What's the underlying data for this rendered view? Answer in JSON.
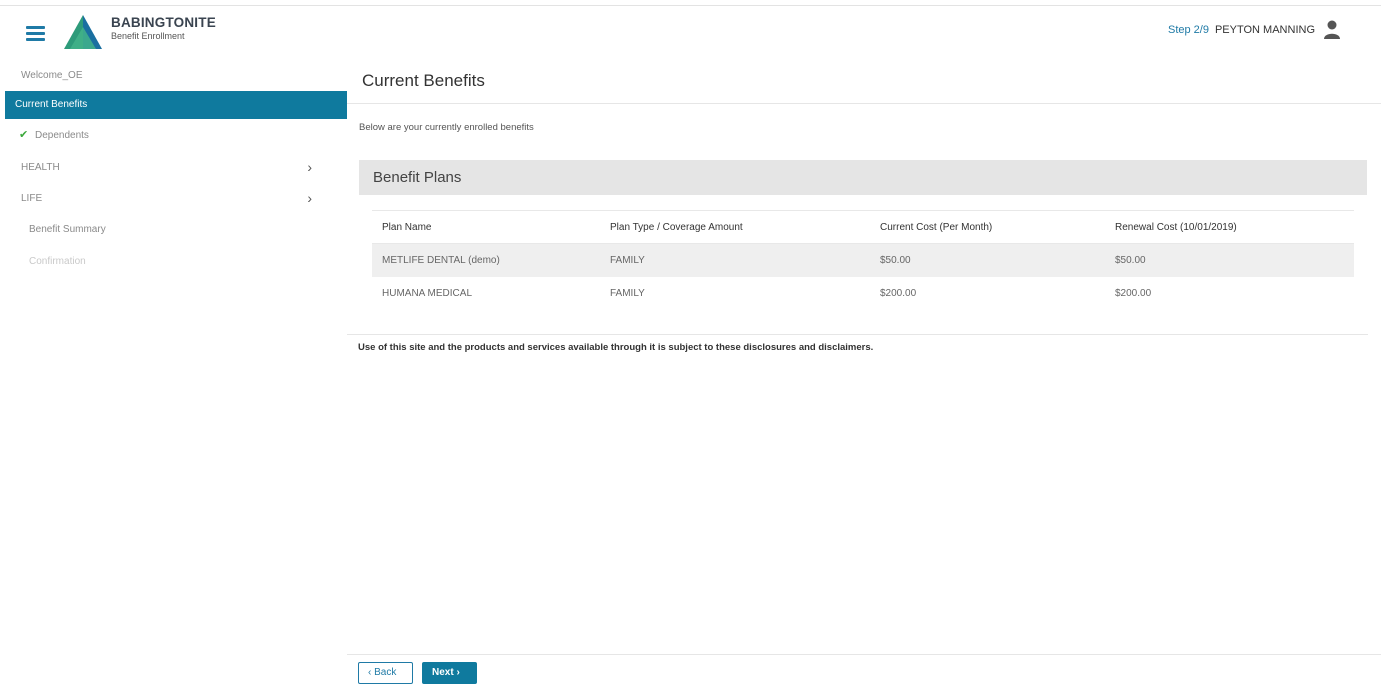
{
  "header": {
    "brand_name": "BABINGTONITE",
    "brand_sub": "Benefit Enrollment",
    "step": "Step 2/9",
    "user_name": "PEYTON MANNING"
  },
  "sidebar": {
    "items": [
      {
        "label": "Welcome_OE"
      },
      {
        "label": "Current Benefits"
      },
      {
        "label": "Dependents"
      },
      {
        "label": "HEALTH"
      },
      {
        "label": "LIFE"
      },
      {
        "label": "Benefit Summary"
      },
      {
        "label": "Confirmation"
      }
    ]
  },
  "main": {
    "title": "Current Benefits",
    "intro": "Below are your currently enrolled benefits",
    "section_title": "Benefit Plans",
    "columns": [
      "Plan Name",
      "Plan Type / Coverage Amount",
      "Current Cost (Per Month)",
      "Renewal Cost (10/01/2019)"
    ],
    "rows": [
      [
        "METLIFE DENTAL (demo)",
        "FAMILY",
        "$50.00",
        "$50.00"
      ],
      [
        "HUMANA MEDICAL",
        "FAMILY",
        "$200.00",
        "$200.00"
      ]
    ],
    "disclaimer": "Use of this site and the products and services available through it is subject to these disclosures and disclaimers."
  },
  "footer": {
    "back_label": "Back",
    "next_label": "Next"
  },
  "colors": {
    "accent": "#0f7a9e",
    "link": "#1f7aa6",
    "check": "#3aa83a"
  }
}
